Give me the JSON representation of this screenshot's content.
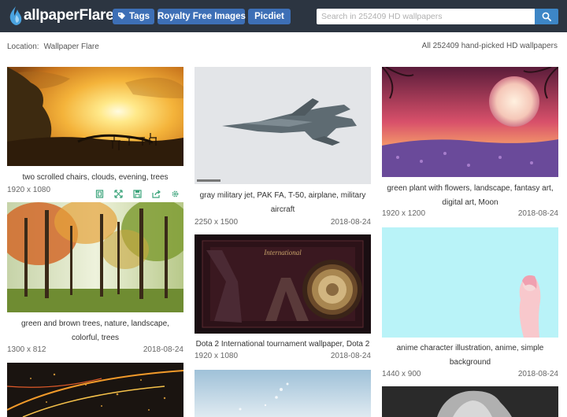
{
  "header": {
    "logo_text": "allpaperFlare",
    "nav": [
      {
        "label": "Tags",
        "icon": "tag-icon"
      },
      {
        "label": "Royalty Free Images"
      },
      {
        "label": "Picdiet"
      }
    ],
    "search": {
      "placeholder": "Search in 252409 HD wallpapers",
      "value": ""
    },
    "search_button_icon": "search-icon"
  },
  "location": {
    "label": "Location:",
    "site": "Wallpaper Flare"
  },
  "total_text": "All 252409 hand-picked HD wallpapers",
  "cards": [
    {
      "caption": "two scrolled chairs, clouds, evening, trees",
      "resolution": "1920 x 1080",
      "date": ""
    },
    {
      "caption": "green and brown trees, nature, landscape, colorful, trees",
      "resolution": "1300 x 812",
      "date": "2018-08-24"
    },
    {
      "caption": "gray military jet, PAK FA, T-50, airplane, military aircraft",
      "resolution": "2250 x 1500",
      "date": "2018-08-24"
    },
    {
      "caption": "Dota 2 International tournament wallpaper, Dota 2",
      "resolution": "1920 x 1080",
      "date": "2018-08-24"
    },
    {
      "caption": "green plant with flowers, landscape, fantasy art, digital art, Moon",
      "resolution": "1920 x 1200",
      "date": "2018-08-24"
    },
    {
      "caption": "anime character illustration, anime, simple background",
      "resolution": "1440 x 900",
      "date": "2018-08-24"
    }
  ],
  "toolbar_icons": [
    "fullscreen-icon",
    "expand-icon",
    "save-icon",
    "share-icon",
    "settings-icon"
  ],
  "colors": {
    "header_bg": "#2c3541",
    "nav_btn": "#3d6fb6",
    "search_btn": "#3d86c6",
    "toolbar_icon": "#3aa37a"
  }
}
